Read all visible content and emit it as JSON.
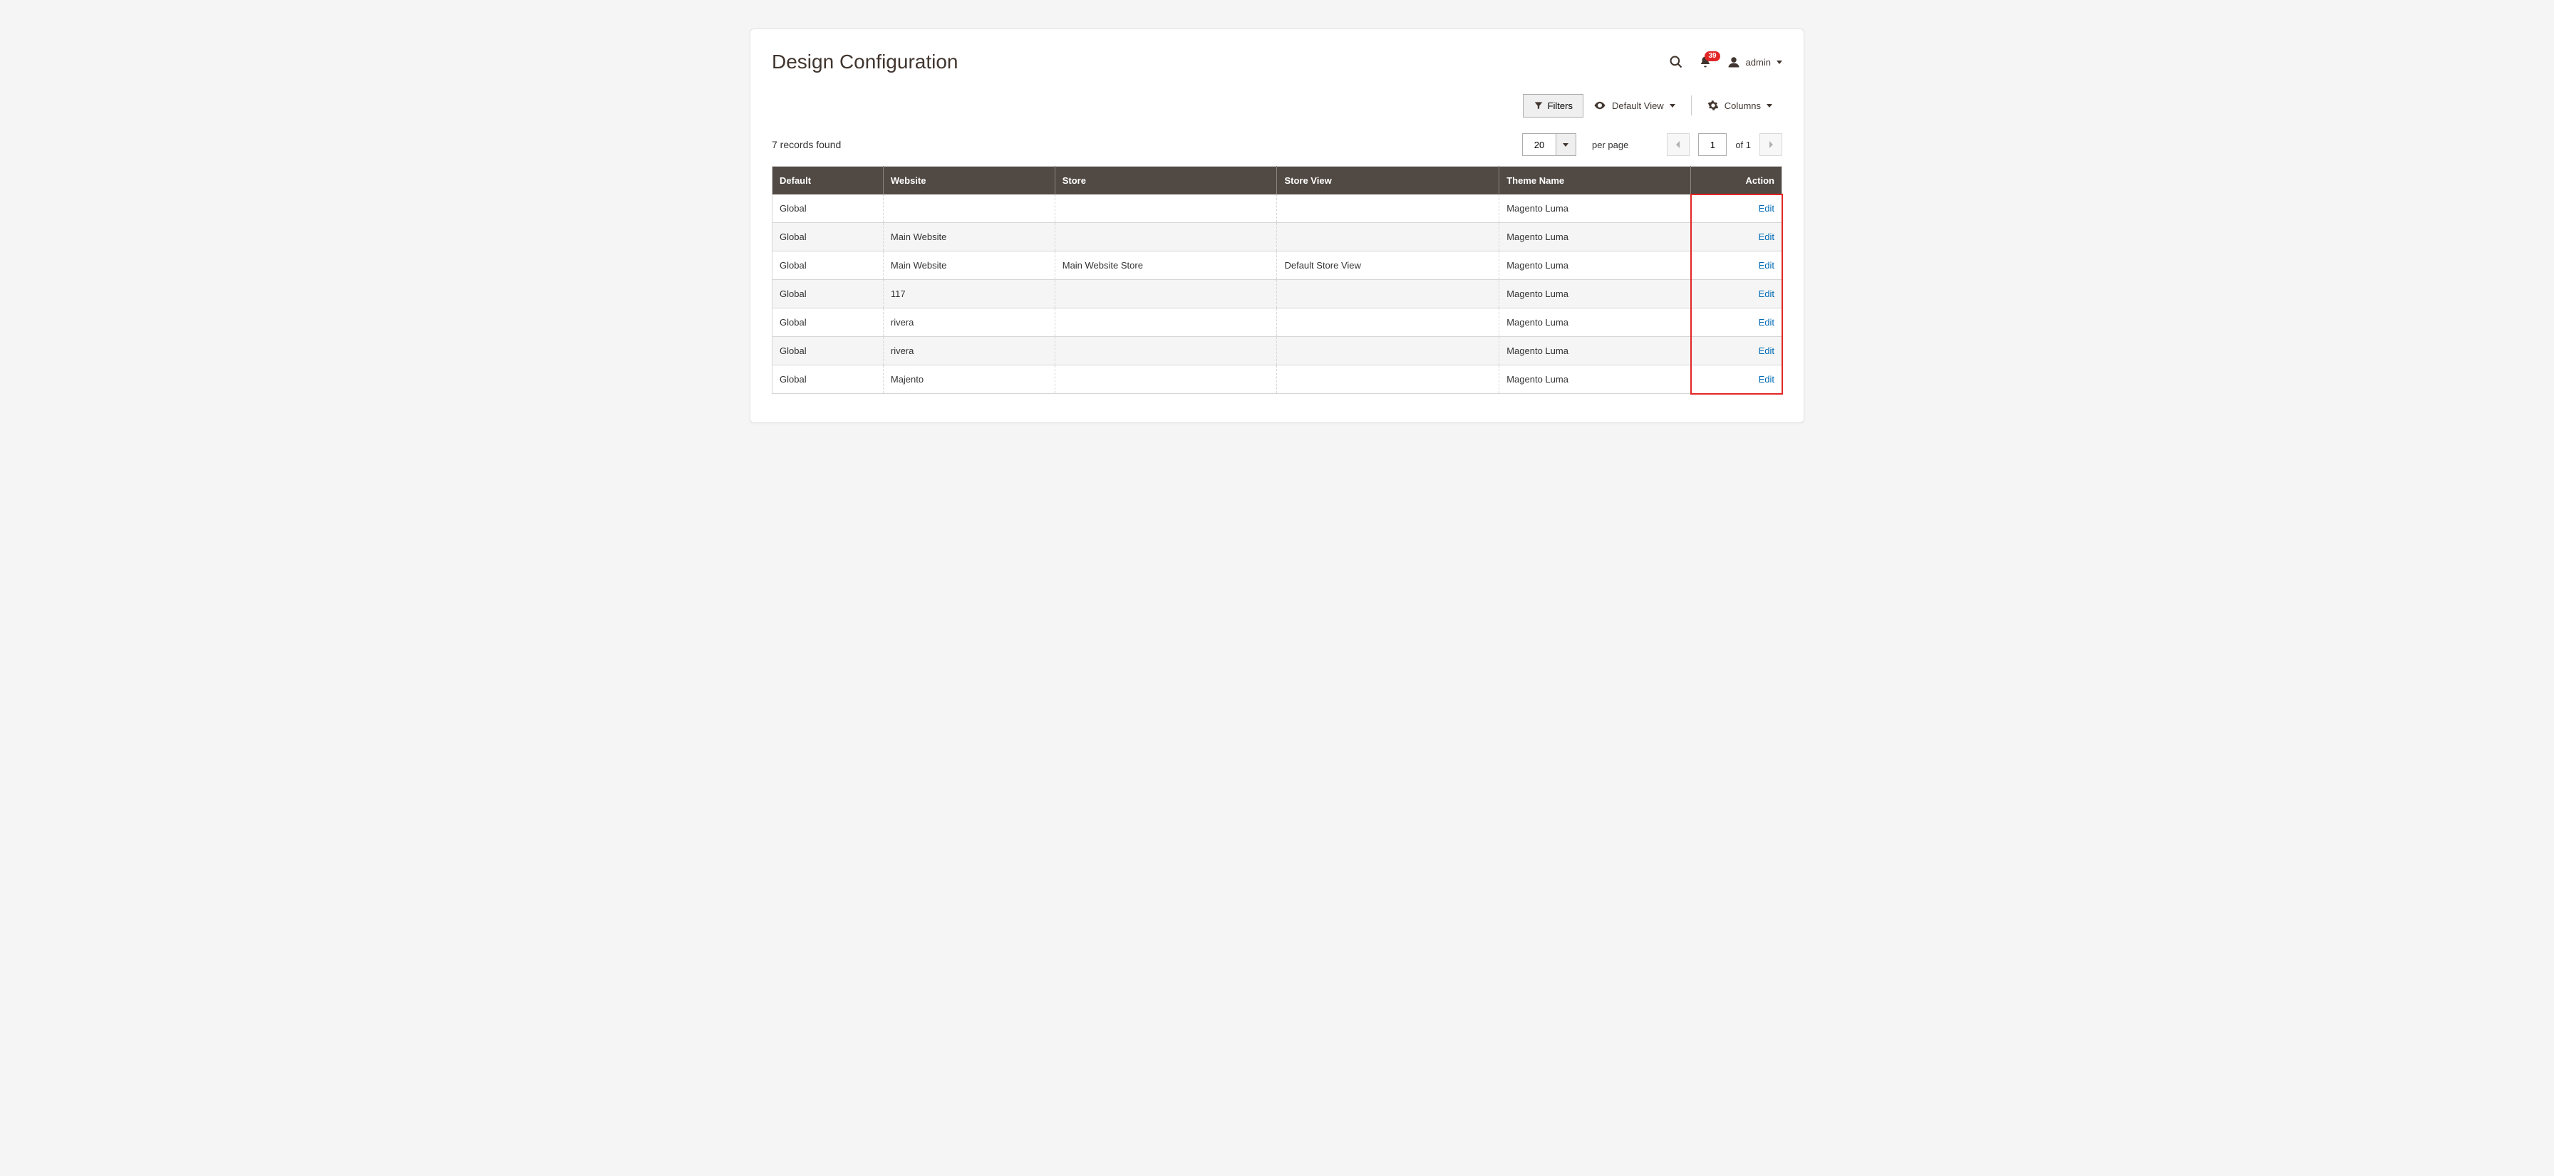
{
  "header": {
    "title": "Design Configuration",
    "notification_count": "39",
    "user_label": "admin"
  },
  "toolbar": {
    "filters_label": "Filters",
    "view_label": "Default View",
    "columns_label": "Columns"
  },
  "status": {
    "records_found": "7 records found",
    "page_size": "20",
    "per_page_label": "per page",
    "current_page": "1",
    "of_label": "of 1"
  },
  "table": {
    "headers": [
      "Default",
      "Website",
      "Store",
      "Store View",
      "Theme Name",
      "Action"
    ],
    "action_label": "Edit",
    "rows": [
      {
        "default": "Global",
        "website": "",
        "store": "",
        "store_view": "",
        "theme": "Magento Luma"
      },
      {
        "default": "Global",
        "website": "Main Website",
        "store": "",
        "store_view": "",
        "theme": "Magento Luma"
      },
      {
        "default": "Global",
        "website": "Main Website",
        "store": "Main Website Store",
        "store_view": "Default Store View",
        "theme": "Magento Luma"
      },
      {
        "default": "Global",
        "website": "117",
        "store": "",
        "store_view": "",
        "theme": "Magento Luma"
      },
      {
        "default": "Global",
        "website": "rivera",
        "store": "",
        "store_view": "",
        "theme": "Magento Luma"
      },
      {
        "default": "Global",
        "website": "rivera",
        "store": "",
        "store_view": "",
        "theme": "Magento Luma"
      },
      {
        "default": "Global",
        "website": "Majento",
        "store": "",
        "store_view": "",
        "theme": "Magento Luma"
      }
    ]
  }
}
